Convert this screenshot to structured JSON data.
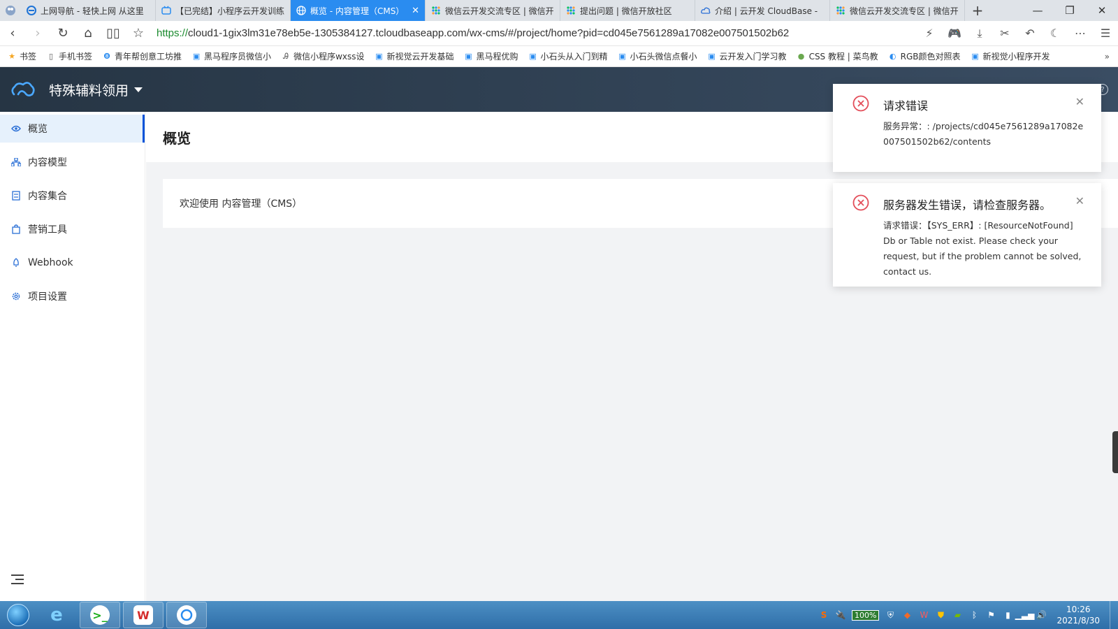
{
  "browser": {
    "tabs": [
      {
        "title": "上网导航 - 轻快上网 从这里",
        "icon": "ie-icon",
        "active": false
      },
      {
        "title": "【已完结】小程序云开发训练",
        "icon": "bilibili-icon",
        "active": false
      },
      {
        "title": "概览 - 内容管理（CMS）",
        "icon": "globe-icon",
        "active": true
      },
      {
        "title": "微信云开发交流专区 | 微信开",
        "icon": "wechat-dev-icon",
        "active": false
      },
      {
        "title": "提出问题 | 微信开放社区",
        "icon": "wechat-dev-icon",
        "active": false
      },
      {
        "title": "介绍 | 云开发 CloudBase -",
        "icon": "cloud-icon",
        "active": false
      },
      {
        "title": "微信云开发交流专区 | 微信开",
        "icon": "wechat-dev-icon",
        "active": false
      }
    ],
    "url_scheme": "https://",
    "url_rest": "cloud1-1gix3lm31e78eb5e-1305384127.tcloudbaseapp.com/wx-cms/#/project/home?pid=cd045e7561289a17082e007501502b62",
    "bookmarks": [
      {
        "label": "书签",
        "icon": "star-icon"
      },
      {
        "label": "手机书签",
        "icon": "phone-icon"
      },
      {
        "label": "青年帮创意工坊推",
        "icon": "badge-icon"
      },
      {
        "label": "黑马程序员微信小",
        "icon": "bilibili-icon"
      },
      {
        "label": "微信小程序wxss设",
        "icon": "pen-icon"
      },
      {
        "label": "新视觉云开发基础",
        "icon": "bilibili-icon"
      },
      {
        "label": "黑马程优购",
        "icon": "bilibili-icon"
      },
      {
        "label": "小石头从入门到精",
        "icon": "bilibili-icon"
      },
      {
        "label": "小石头微信点餐小",
        "icon": "bilibili-icon"
      },
      {
        "label": "云开发入门学习教",
        "icon": "bilibili-icon"
      },
      {
        "label": "CSS 教程 | 菜鸟教",
        "icon": "runoob-icon"
      },
      {
        "label": "RGB颜色对照表",
        "icon": "color-icon"
      },
      {
        "label": "新视觉小程序开发",
        "icon": "bilibili-icon"
      }
    ]
  },
  "cms": {
    "project_name": "特殊辅料领用",
    "menu": [
      {
        "key": "overview",
        "label": "概览",
        "icon": "eye-icon",
        "active": true
      },
      {
        "key": "content-model",
        "label": "内容模型",
        "icon": "hierarchy-icon",
        "active": false
      },
      {
        "key": "content-collection",
        "label": "内容集合",
        "icon": "list-icon",
        "active": false
      },
      {
        "key": "marketing-tools",
        "label": "营销工具",
        "icon": "bag-icon",
        "active": false
      },
      {
        "key": "webhook",
        "label": "Webhook",
        "icon": "rocket-icon",
        "active": false
      },
      {
        "key": "project-settings",
        "label": "项目设置",
        "icon": "gear-icon",
        "active": false
      }
    ],
    "page_title": "概览",
    "welcome_text": "欢迎使用 内容管理（CMS）"
  },
  "toasts": [
    {
      "title": "请求错误",
      "body": "服务异常：: /projects/cd045e7561289a17082e007501502b62/contents"
    },
    {
      "title": "服务器发生错误，请检查服务器。",
      "body": "请求错误：【SYS_ERR】: [ResourceNotFound] Db or Table not exist. Please check your request, but if the problem cannot be solved, contact us."
    }
  ],
  "taskbar": {
    "battery": "100%",
    "time": "10:26",
    "date": "2021/8/30"
  },
  "colors": {
    "active_tab": "#2a8cf0",
    "header_bg": "#263544",
    "error_red": "#e34d59",
    "menu_active_bg": "#e6f1fc",
    "menu_active_border": "#0052d9"
  }
}
